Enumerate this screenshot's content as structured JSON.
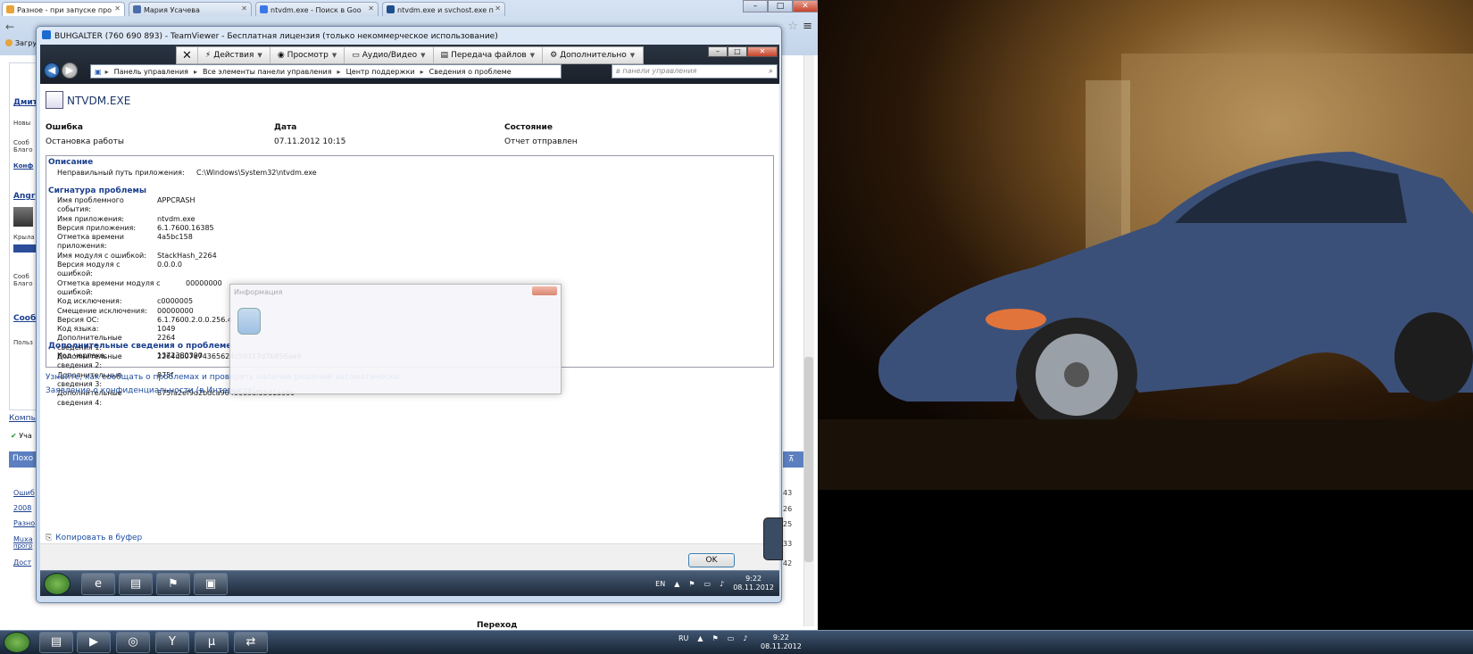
{
  "browser": {
    "tabs": [
      {
        "label": "Разное - при запуске про",
        "color": "#e8a33a"
      },
      {
        "label": "Мария Усачева",
        "color": "#4a6ea9"
      },
      {
        "label": "ntvdm.exe - Поиск в Goo",
        "color": "#3b78e7"
      },
      {
        "label": "ntvdm.exe и svchost.exe п",
        "color": "#1f4f8f"
      }
    ],
    "bookmark_label": "Загру",
    "left_links": [
      "Дмит",
      "Angr",
      "Сооб",
      "Конф"
    ],
    "left_small": [
      "Новы",
      "Сооб",
      "Благо",
      "Крыла",
      "Сооб",
      "Благо",
      "Польз"
    ],
    "left_bottom_links": [
      "Компь",
      "Уча",
      "Похо"
    ],
    "similar_rows": [
      "Ошиб",
      "2008",
      "Разно",
      "Muxa",
      "прогр",
      "Дост"
    ],
    "times": [
      "43",
      "26",
      "25",
      "33",
      "42"
    ],
    "page_nav": "Переход"
  },
  "teamviewer": {
    "title": "BUHGALTER (760 690 893) - TeamViewer - Бесплатная лицензия (только некоммерческое использование)",
    "toolbar": {
      "close": "✕",
      "actions": "Действия",
      "view": "Просмотр",
      "audio_video": "Аудио/Видео",
      "file_transfer": "Передача файлов",
      "extra": "Дополнительно"
    }
  },
  "explorer": {
    "breadcrumbs": [
      "Панель управления",
      "Все элементы панели управления",
      "Центр поддержки",
      "Сведения о проблеме"
    ],
    "search_placeholder": "в панели управления"
  },
  "problem": {
    "app_name": "NTVDM.EXE",
    "col_error": "Ошибка",
    "col_date": "Дата",
    "col_status": "Состояние",
    "error_val": "Остановка работы",
    "date_val": "07.11.2012 10:15",
    "status_val": "Отчет отправлен",
    "desc_title": "Описание",
    "desc_key": "Неправильный путь приложения:",
    "desc_val": "C:\\Windows\\System32\\ntvdm.exe",
    "sig_title": "Сигнатура проблемы",
    "signature": [
      {
        "k": "Имя проблемного события:",
        "v": "APPCRASH"
      },
      {
        "k": "Имя приложения:",
        "v": "ntvdm.exe"
      },
      {
        "k": "Версия приложения:",
        "v": "6.1.7600.16385"
      },
      {
        "k": "Отметка времени приложения:",
        "v": "4a5bc158"
      },
      {
        "k": "Имя модуля с ошибкой:",
        "v": "StackHash_2264"
      },
      {
        "k": "Версия модуля с ошибкой:",
        "v": "0.0.0.0"
      },
      {
        "k": "Отметка времени модуля с ошибкой:",
        "v": "00000000"
      },
      {
        "k": "Код исключения:",
        "v": "c0000005"
      },
      {
        "k": "Смещение исключения:",
        "v": "00000000"
      },
      {
        "k": "Версия ОС:",
        "v": "6.1.7600.2.0.0.256.4"
      },
      {
        "k": "Код языка:",
        "v": "1049"
      },
      {
        "k": "Дополнительные сведения 1:",
        "v": "2264"
      },
      {
        "k": "Дополнительные сведения 2:",
        "v": "2264db07e74365624c50317d7b856ae9"
      },
      {
        "k": "Дополнительные сведения 3:",
        "v": "875f"
      },
      {
        "k": "Дополнительные сведения 4:",
        "v": "875fa2ef9d2bdca96466e8af55d1ae6e"
      }
    ],
    "extra_title": "Дополнительные сведения о проблеме",
    "bucket_key": "Код черпака:",
    "bucket_val": "1372380390",
    "link_learn": "Узнайте, как сообщать о проблемах и проверять наличие решений автоматически.",
    "link_privacy": "Заявление о конфиденциальности (в Интернете)",
    "copy_link": "Копировать в буфер",
    "ok_button": "OK"
  },
  "popup": {
    "title": "Информация"
  },
  "remote_taskbar": {
    "lang": "EN",
    "time": "9:22",
    "date": "08.11.2012"
  },
  "host_taskbar": {
    "lang": "RU",
    "time": "9:22",
    "date": "08.11.2012"
  }
}
